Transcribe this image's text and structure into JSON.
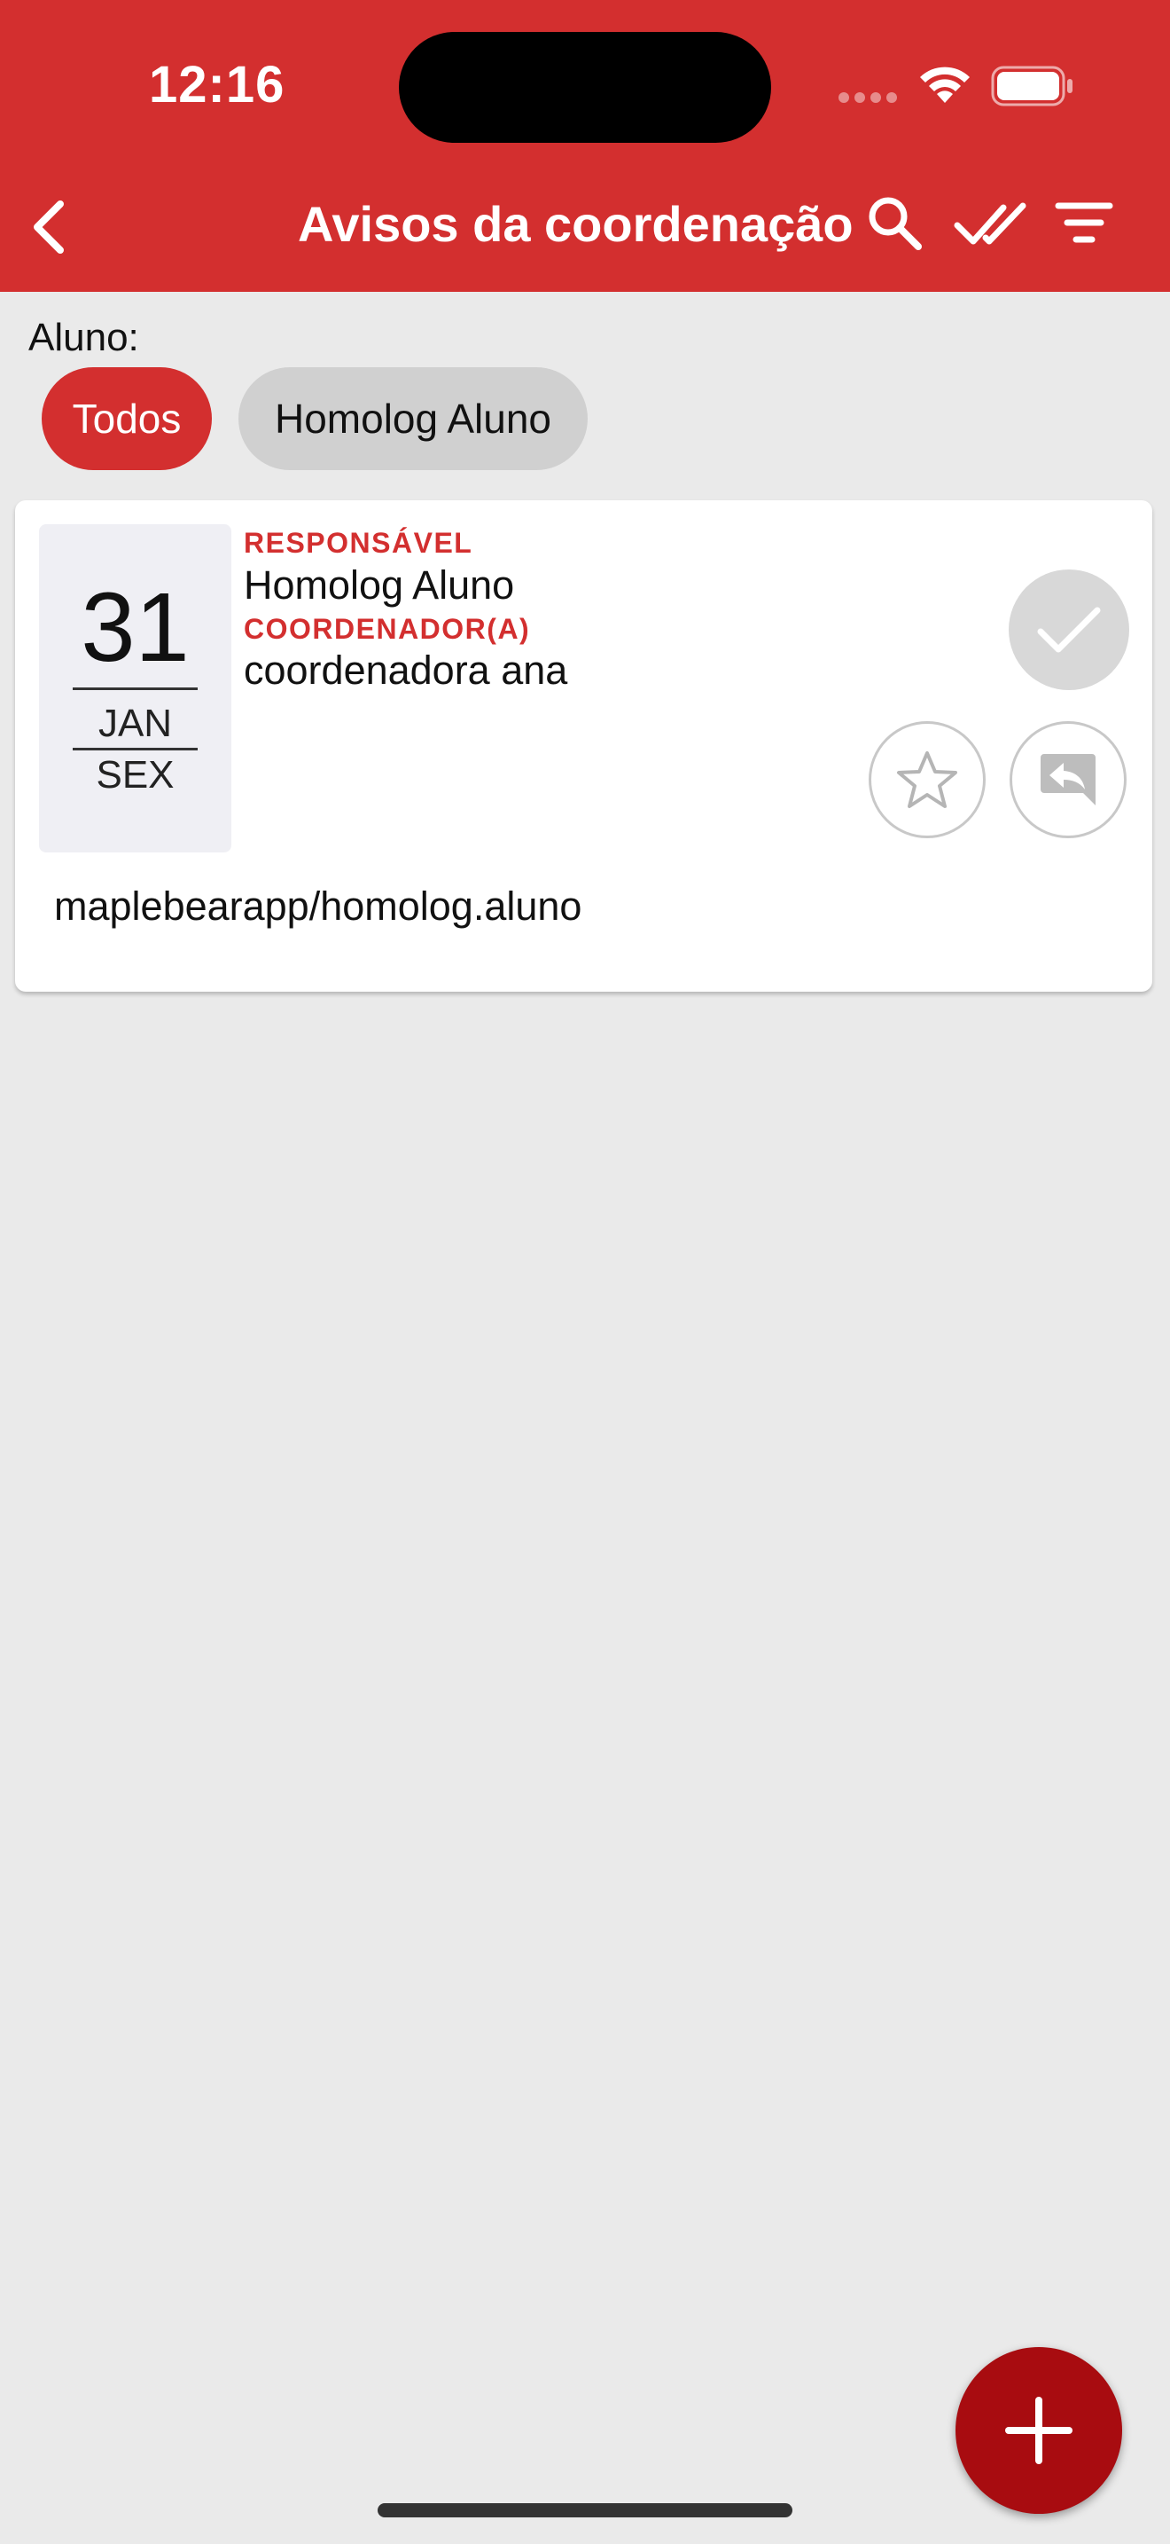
{
  "status_bar": {
    "time": "12:16"
  },
  "nav": {
    "title": "Avisos da coordenação"
  },
  "filter": {
    "label": "Aluno:",
    "chips": [
      {
        "label": "Todos",
        "selected": true
      },
      {
        "label": "Homolog Aluno",
        "selected": false
      }
    ]
  },
  "notice": {
    "date": {
      "day": "31",
      "month": "JAN",
      "weekday": "SEX"
    },
    "sender_role": "RESPONSÁVEL",
    "sender_name": "Homolog Aluno",
    "recipient_role": "COORDENADOR(A)",
    "recipient_name": "coordenadora ana",
    "body": "maplebearapp/homolog.aluno"
  },
  "icons": {
    "nav": [
      "back-arrow-icon",
      "search-icon",
      "double-check-icon",
      "filter-icon"
    ],
    "card": [
      "check-icon",
      "star-icon",
      "reply-icon"
    ],
    "fab": "plus-icon"
  },
  "colors": {
    "brand_red": "#D32F2F",
    "fab_red": "#A80C10",
    "background": "#EAEAEA"
  }
}
